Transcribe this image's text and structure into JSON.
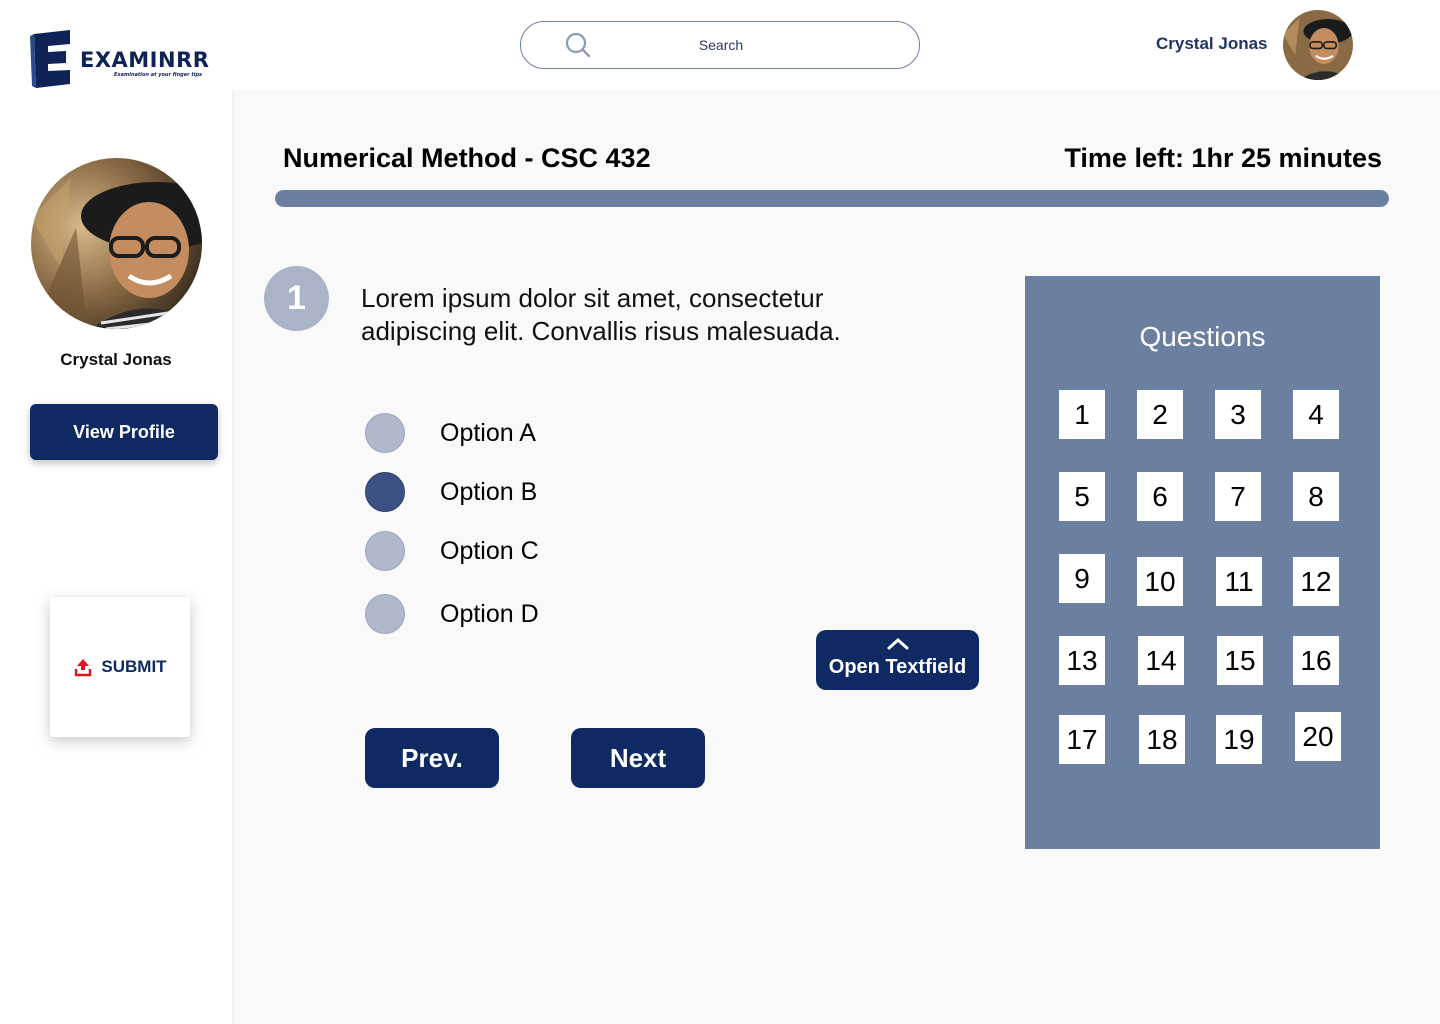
{
  "brand": {
    "name": "EXAMINRR",
    "tagline": "Examination at your finger tips"
  },
  "user": {
    "name": "Crystal Jonas"
  },
  "sidebar": {
    "view_profile_label": "View Profile",
    "submit_label": "SUBMIT"
  },
  "header": {
    "search_placeholder": "Search",
    "user_name": "Crystal Jonas"
  },
  "exam": {
    "course_title": "Numerical Method - CSC 432",
    "time_left": "Time left: 1hr 25 minutes",
    "progress": 1.0
  },
  "question": {
    "number": "1",
    "text": "Lorem ipsum dolor sit amet, consectetur adipiscing elit. Convallis risus malesuada.",
    "options": [
      {
        "label": "Option A",
        "selected": false
      },
      {
        "label": "Option B",
        "selected": true
      },
      {
        "label": "Option C",
        "selected": false
      },
      {
        "label": "Option D",
        "selected": false
      }
    ]
  },
  "actions": {
    "open_textfield_label": "Open Textfield",
    "prev_label": "Prev.",
    "next_label": "Next"
  },
  "questions_panel": {
    "title": "Questions",
    "numbers": [
      "1",
      "2",
      "3",
      "4",
      "5",
      "6",
      "7",
      "8",
      "9",
      "10",
      "11",
      "12",
      "13",
      "14",
      "15",
      "16",
      "17",
      "18",
      "19",
      "20"
    ]
  },
  "colors": {
    "primary": "#0f2a63",
    "panel": "#6b7fa1",
    "radio_unselected": "#b0b9cc",
    "radio_selected": "#3a5181",
    "submit_icon": "#e0141e"
  },
  "icons": {
    "search": "search-icon",
    "upload": "upload-icon",
    "chevron": "chevron-up-icon"
  }
}
